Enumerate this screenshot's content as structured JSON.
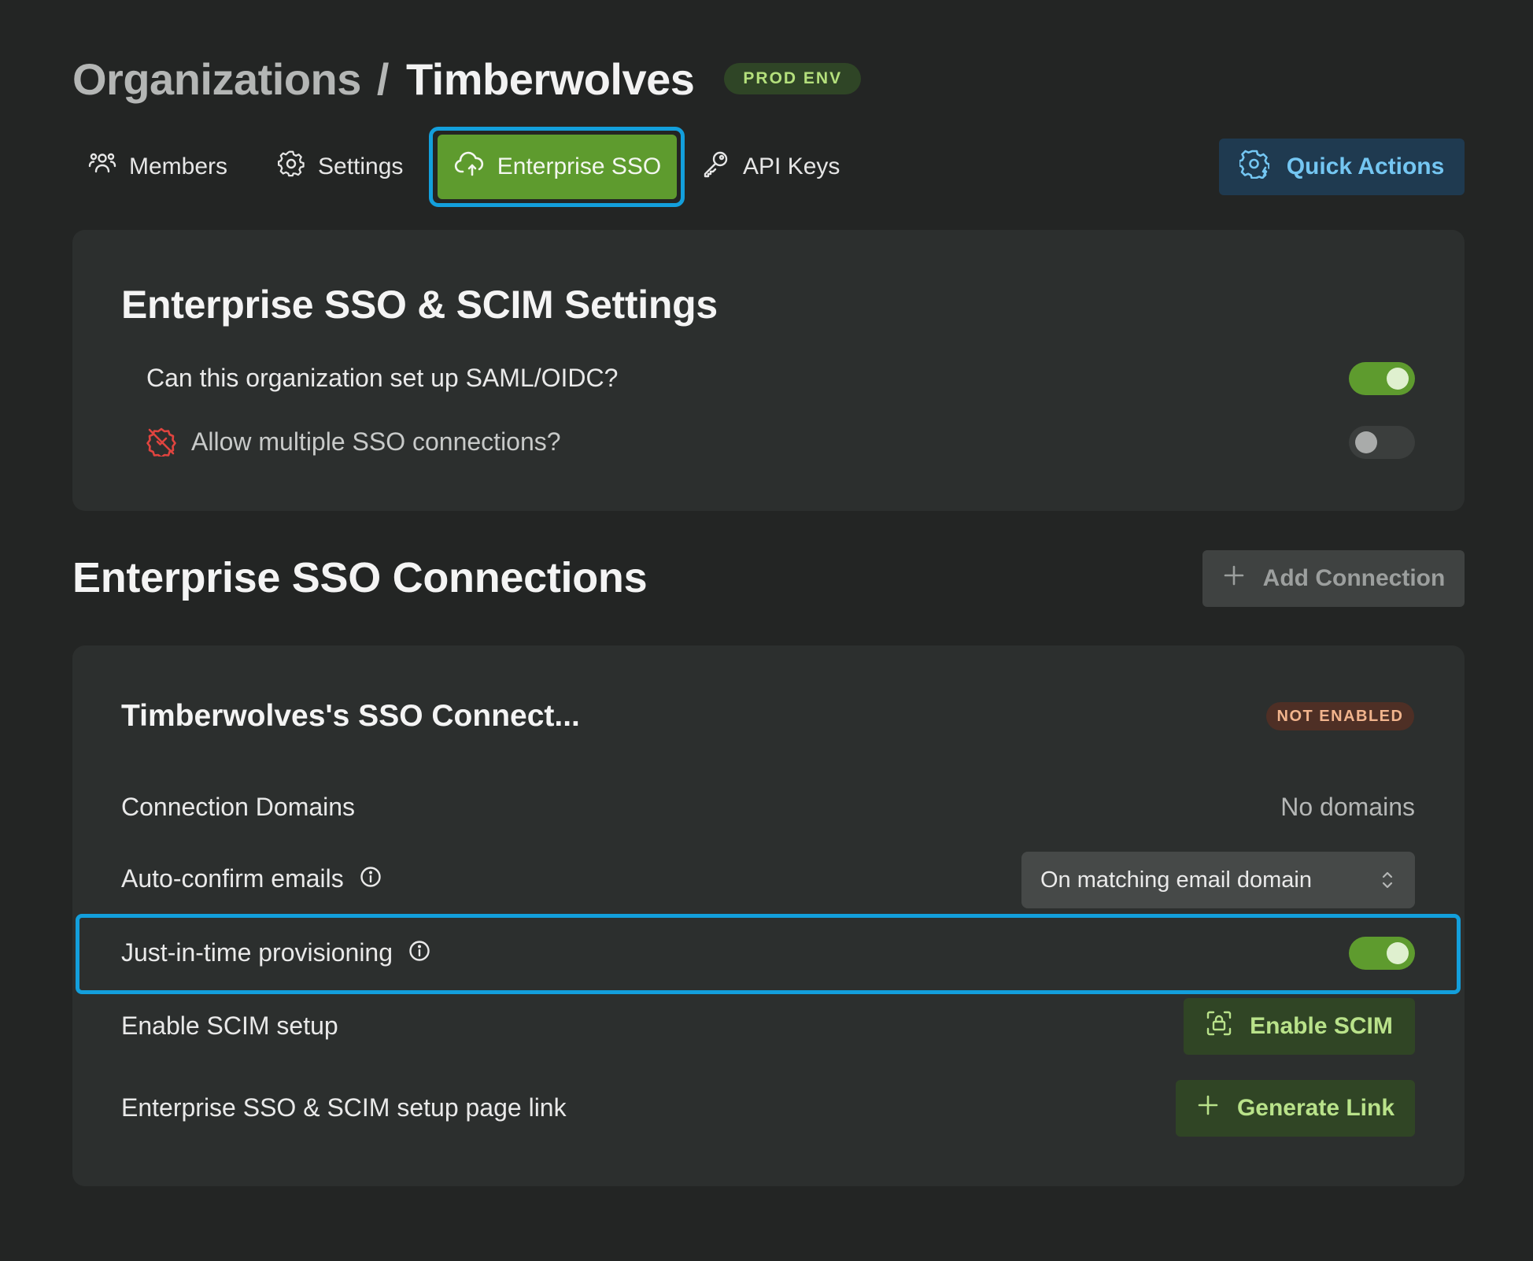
{
  "breadcrumb": {
    "parent": "Organizations",
    "separator": "/",
    "current": "Timberwolves",
    "env_badge": "PROD ENV"
  },
  "tabs": [
    {
      "label": "Members",
      "icon": "members-icon"
    },
    {
      "label": "Settings",
      "icon": "gear-icon"
    },
    {
      "label": "Enterprise SSO",
      "icon": "cloud-sso-icon",
      "active": true
    },
    {
      "label": "API Keys",
      "icon": "key-icon"
    }
  ],
  "quick_actions": {
    "label": "Quick Actions",
    "icon": "gear-bolt-icon"
  },
  "settings_card": {
    "title": "Enterprise SSO & SCIM Settings",
    "rows": [
      {
        "label": "Can this organization set up SAML/OIDC?",
        "enabled": true
      },
      {
        "label": "Allow multiple SSO connections?",
        "enabled": false,
        "icon": "disabled-badge-icon"
      }
    ]
  },
  "connections": {
    "title": "Enterprise SSO Connections",
    "add_button": "Add Connection"
  },
  "connection_card": {
    "title": "Timberwolves's SSO Connect...",
    "status": "NOT ENABLED",
    "domains_label": "Connection Domains",
    "domains_value": "No domains",
    "auto_confirm_label": "Auto-confirm emails",
    "auto_confirm_value": "On matching email domain",
    "jit_label": "Just-in-time provisioning",
    "jit_enabled": true,
    "scim_label": "Enable SCIM setup",
    "scim_button": "Enable SCIM",
    "link_label": "Enterprise SSO & SCIM setup page link",
    "link_button": "Generate Link"
  },
  "colors": {
    "background": "#232524",
    "card": "#2c2f2e",
    "accent_green": "#5e9b2e",
    "highlight_blue": "#139fdc",
    "quick_actions_text": "#74c6f2",
    "danger_red": "#e0443f"
  }
}
